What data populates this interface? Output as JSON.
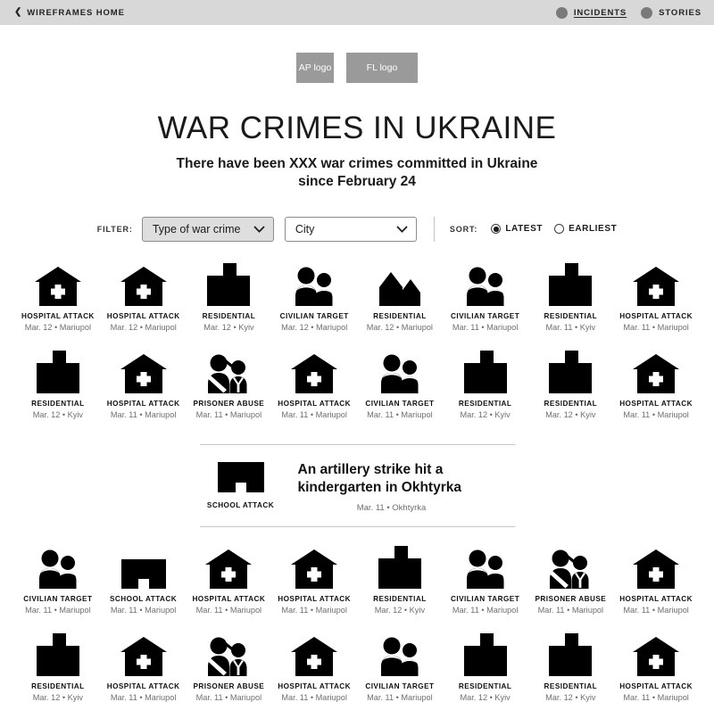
{
  "topbar": {
    "home_label": "WIREFRAMES HOME",
    "back_chevron": "chevron-left-icon",
    "nav": [
      {
        "label": "INCIDENTS",
        "active": true
      },
      {
        "label": "STORIES",
        "active": false
      }
    ]
  },
  "logos": {
    "ap": "AP logo",
    "fl": "FL logo"
  },
  "header": {
    "title": "WAR CRIMES IN UKRAINE",
    "subtitle": "There have been XXX war crimes committed in Ukraine since February 24"
  },
  "controls": {
    "filter_label": "FILTER:",
    "filter_type_value": "Type of war crime",
    "filter_city_value": "City",
    "sort_label": "SORT:",
    "sort_options": [
      {
        "label": "LATEST",
        "selected": true
      },
      {
        "label": "EARLIEST",
        "selected": false
      }
    ]
  },
  "feature": {
    "icon": "school-attack-icon",
    "type": "SCHOOL ATTACK",
    "headline": "An artillery strike hit a kindergarten in Okhtyrka",
    "meta": "Mar. 11 • Okhtyrka"
  },
  "colors": {
    "topbar_bg": "#d8d8d8",
    "logo_placeholder": "#9a9a9a",
    "icon_fill": "#000000",
    "meta_text": "#6f6f6f",
    "select_filled": "#dedede"
  },
  "rows": [
    {
      "name": "incident-row-1",
      "cards": [
        {
          "icon": "hospital",
          "type": "HOSPITAL ATTACK",
          "meta": "Mar. 12 • Mariupol"
        },
        {
          "icon": "hospital",
          "type": "HOSPITAL ATTACK",
          "meta": "Mar. 12 • Mariupol"
        },
        {
          "icon": "residential-block",
          "type": "RESIDENTIAL",
          "meta": "Mar. 12 • Kyiv"
        },
        {
          "icon": "civilian",
          "type": "CIVILIAN TARGET",
          "meta": "Mar. 12 • Mariupol"
        },
        {
          "icon": "residential-houses",
          "type": "RESIDENTIAL",
          "meta": "Mar. 12 • Mariupol"
        },
        {
          "icon": "civilian",
          "type": "CIVILIAN TARGET",
          "meta": "Mar. 11 • Mariupol"
        },
        {
          "icon": "residential-block",
          "type": "RESIDENTIAL",
          "meta": "Mar. 11 • Kyiv"
        },
        {
          "icon": "hospital",
          "type": "HOSPITAL ATTACK",
          "meta": "Mar. 11 • Mariupol"
        }
      ]
    },
    {
      "name": "incident-row-2",
      "cards": [
        {
          "icon": "residential-block",
          "type": "RESIDENTIAL",
          "meta": "Mar. 12 • Kyiv"
        },
        {
          "icon": "hospital",
          "type": "HOSPITAL ATTACK",
          "meta": "Mar. 11 • Mariupol"
        },
        {
          "icon": "prisoner",
          "type": "PRISONER ABUSE",
          "meta": "Mar. 11 • Mariupol"
        },
        {
          "icon": "hospital",
          "type": "HOSPITAL ATTACK",
          "meta": "Mar. 11 • Mariupol"
        },
        {
          "icon": "civilian",
          "type": "CIVILIAN TARGET",
          "meta": "Mar. 11 • Mariupol"
        },
        {
          "icon": "residential-block",
          "type": "RESIDENTIAL",
          "meta": "Mar. 12 • Kyiv"
        },
        {
          "icon": "residential-block",
          "type": "RESIDENTIAL",
          "meta": "Mar. 12 • Kyiv"
        },
        {
          "icon": "hospital",
          "type": "HOSPITAL ATTACK",
          "meta": "Mar. 11 • Mariupol"
        }
      ]
    },
    {
      "name": "incident-row-3",
      "cards": [
        {
          "icon": "civilian",
          "type": "CIVILIAN TARGET",
          "meta": "Mar. 11 • Mariupol"
        },
        {
          "icon": "school",
          "type": "SCHOOL ATTACK",
          "meta": "Mar. 11 • Mariupol"
        },
        {
          "icon": "hospital",
          "type": "HOSPITAL ATTACK",
          "meta": "Mar. 11 • Mariupol"
        },
        {
          "icon": "hospital",
          "type": "HOSPITAL ATTACK",
          "meta": "Mar. 11 • Mariupol"
        },
        {
          "icon": "residential-block",
          "type": "RESIDENTIAL",
          "meta": "Mar. 12 • Kyiv"
        },
        {
          "icon": "civilian",
          "type": "CIVILIAN TARGET",
          "meta": "Mar. 11 • Mariupol"
        },
        {
          "icon": "prisoner",
          "type": "PRISONER ABUSE",
          "meta": "Mar. 11 • Mariupol"
        },
        {
          "icon": "hospital",
          "type": "HOSPITAL ATTACK",
          "meta": "Mar. 11 • Mariupol"
        }
      ]
    },
    {
      "name": "incident-row-4",
      "cards": [
        {
          "icon": "residential-block",
          "type": "RESIDENTIAL",
          "meta": "Mar. 12 • Kyiv"
        },
        {
          "icon": "hospital",
          "type": "HOSPITAL ATTACK",
          "meta": "Mar. 11 • Mariupol"
        },
        {
          "icon": "prisoner",
          "type": "PRISONER ABUSE",
          "meta": "Mar. 11 • Mariupol"
        },
        {
          "icon": "hospital",
          "type": "HOSPITAL ATTACK",
          "meta": "Mar. 11 • Mariupol"
        },
        {
          "icon": "civilian",
          "type": "CIVILIAN TARGET",
          "meta": "Mar. 11 • Mariupol"
        },
        {
          "icon": "residential-block",
          "type": "RESIDENTIAL",
          "meta": "Mar. 12 • Kyiv"
        },
        {
          "icon": "residential-block",
          "type": "RESIDENTIAL",
          "meta": "Mar. 12 • Kyiv"
        },
        {
          "icon": "hospital",
          "type": "HOSPITAL ATTACK",
          "meta": "Mar. 11 • Mariupol"
        }
      ]
    }
  ]
}
